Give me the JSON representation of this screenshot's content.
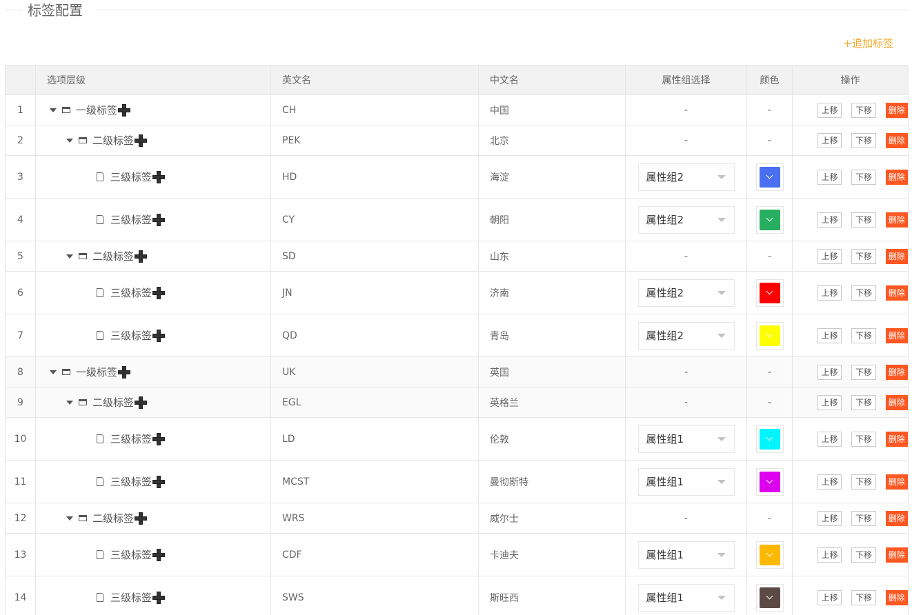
{
  "page": {
    "title": "标签配置",
    "add_label": "+追加标签"
  },
  "table": {
    "headers": {
      "num": "",
      "level": "选项层级",
      "en": "英文名",
      "cn": "中文名",
      "attr": "属性组选择",
      "color": "颜色",
      "ops": "操作"
    },
    "ops_labels": {
      "up": "上移",
      "down": "下移",
      "delete": "删除"
    },
    "rows": [
      {
        "num": "1",
        "depth": 1,
        "level_label": "一级标签",
        "en": "CH",
        "cn": "中国",
        "attr": "-",
        "color": "-"
      },
      {
        "num": "2",
        "depth": 2,
        "level_label": "二级标签",
        "en": "PEK",
        "cn": "北京",
        "attr": "-",
        "color": "-"
      },
      {
        "num": "3",
        "depth": 3,
        "level_label": "三级标签",
        "en": "HD",
        "cn": "海淀",
        "attr": "属性组2",
        "color": "#4a6ff0"
      },
      {
        "num": "4",
        "depth": 3,
        "level_label": "三级标签",
        "en": "CY",
        "cn": "朝阳",
        "attr": "属性组2",
        "color": "#27ae60"
      },
      {
        "num": "5",
        "depth": 2,
        "level_label": "二级标签",
        "en": "SD",
        "cn": "山东",
        "attr": "-",
        "color": "-"
      },
      {
        "num": "6",
        "depth": 3,
        "level_label": "三级标签",
        "en": "JN",
        "cn": "济南",
        "attr": "属性组2",
        "color": "#ff0000"
      },
      {
        "num": "7",
        "depth": 3,
        "level_label": "三级标签",
        "en": "QD",
        "cn": "青岛",
        "attr": "属性组2",
        "color": "#ffff00"
      },
      {
        "num": "8",
        "depth": 1,
        "level_label": "一级标签",
        "en": "UK",
        "cn": "英国",
        "attr": "-",
        "color": "-"
      },
      {
        "num": "9",
        "depth": 2,
        "level_label": "二级标签",
        "en": "EGL",
        "cn": "英格兰",
        "attr": "-",
        "color": "-"
      },
      {
        "num": "10",
        "depth": 3,
        "level_label": "三级标签",
        "en": "LD",
        "cn": "伦敦",
        "attr": "属性组1",
        "color": "#00f5ff"
      },
      {
        "num": "11",
        "depth": 3,
        "level_label": "三级标签",
        "en": "MCST",
        "cn": "曼彻斯特",
        "attr": "属性组1",
        "color": "#dd00ee"
      },
      {
        "num": "12",
        "depth": 2,
        "level_label": "二级标签",
        "en": "WRS",
        "cn": "威尔士",
        "attr": "-",
        "color": "-"
      },
      {
        "num": "13",
        "depth": 3,
        "level_label": "三级标签",
        "en": "CDF",
        "cn": "卡迪夫",
        "attr": "属性组1",
        "color": "#ffb800"
      },
      {
        "num": "14",
        "depth": 3,
        "level_label": "三级标签",
        "en": "SWS",
        "cn": "斯旺西",
        "attr": "属性组1",
        "color": "#5b4a44"
      }
    ]
  },
  "icons": {
    "expand": "caret-down-icon",
    "folder": "folder-icon",
    "file": "file-icon",
    "add_child": "plus-icon",
    "dropdown": "dropdown-arrow-icon",
    "color_picker": "chevron-down-icon"
  },
  "colors": {
    "accent": "#f5a623",
    "danger": "#ff5722",
    "header_bg": "#f2f2f2",
    "border": "#e6e6e6"
  }
}
